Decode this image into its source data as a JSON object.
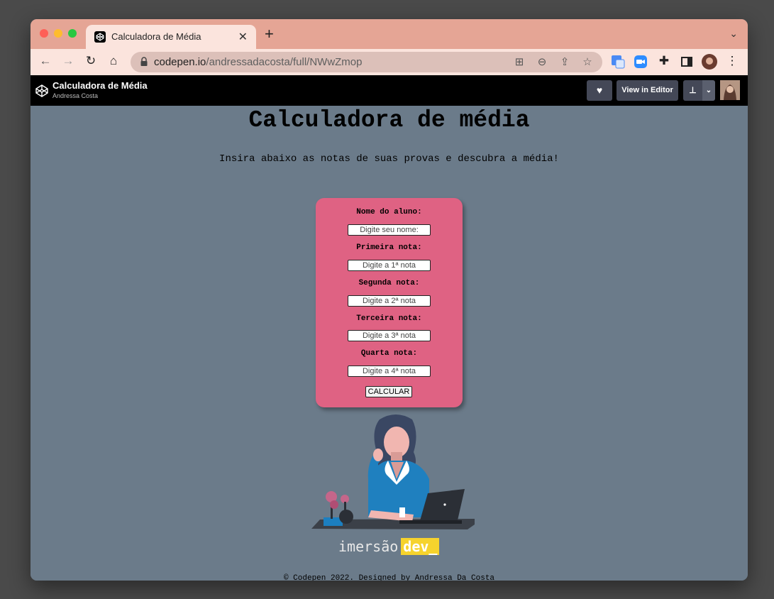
{
  "browser": {
    "tab_title": "Calculadora de Média",
    "url_host": "codepen.io",
    "url_path": "/andressadacosta/full/NWwZmop"
  },
  "codepen_header": {
    "title": "Calculadora de Média",
    "author": "Andressa Costa",
    "view_in_editor_label": "View in Editor"
  },
  "page": {
    "heading": "Calculadora de média",
    "subtitle": "Insira abaixo as notas de suas provas e descubra a média!",
    "form": {
      "name_label": "Nome do aluno:",
      "name_placeholder": "Digite seu nome:",
      "grade1_label": "Primeira nota:",
      "grade1_placeholder": "Digite a 1ª nota",
      "grade2_label": "Segunda nota:",
      "grade2_placeholder": "Digite a 2ª nota",
      "grade3_label": "Terceira nota:",
      "grade3_placeholder": "Digite a 3ª nota",
      "grade4_label": "Quarta nota:",
      "grade4_placeholder": "Digite a 4ª nota",
      "calculate_label": "CALCULAR"
    },
    "logo": {
      "word": "imersão",
      "accent": "dev_"
    },
    "footer": "© Codepen 2022. Designed by Andressa Da Costa"
  },
  "colors": {
    "tabbar": "#e5a595",
    "page_bg": "#6b7b8a",
    "card": "#df6283",
    "logo_accent": "#f6d32d"
  }
}
